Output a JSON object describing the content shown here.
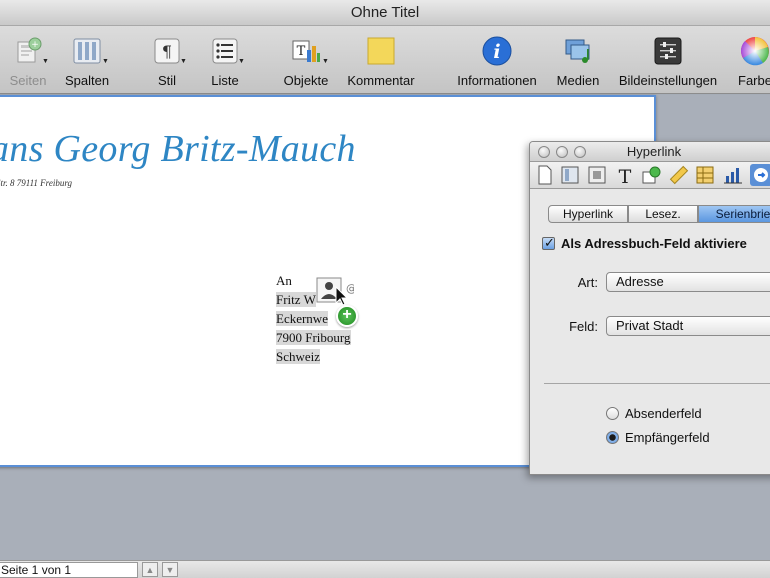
{
  "window": {
    "title": "Ohne Titel"
  },
  "toolbar": {
    "items": [
      {
        "label": "Seiten",
        "icon": "pages-icon",
        "enabled": false
      },
      {
        "label": "Spalten",
        "icon": "columns-icon",
        "enabled": true
      },
      {
        "label": "Stil",
        "icon": "paragraph-style-icon",
        "enabled": true
      },
      {
        "label": "Liste",
        "icon": "list-icon",
        "enabled": true
      },
      {
        "label": "Objekte",
        "icon": "objects-icon",
        "enabled": true
      },
      {
        "label": "Kommentar",
        "icon": "comment-icon",
        "enabled": true
      },
      {
        "label": "Informationen",
        "icon": "info-icon",
        "enabled": true
      },
      {
        "label": "Medien",
        "icon": "media-icon",
        "enabled": true
      },
      {
        "label": "Bildeinstellungen",
        "icon": "image-adjust-icon",
        "enabled": true
      },
      {
        "label": "Farbe",
        "icon": "color-wheel-icon",
        "enabled": true
      }
    ]
  },
  "document": {
    "sender_name": "ans Georg Britz-Mauch",
    "sender_address": "Str. 8 79111 Freiburg",
    "recipient": {
      "salutation": "An",
      "lines": [
        "Fritz W",
        "Eckernwe",
        "7900 Fribourg",
        "Schweiz"
      ]
    }
  },
  "status": {
    "page_info": "Seite 1 von 1",
    "prev_symbol": "▲",
    "next_symbol": "▼"
  },
  "inspector": {
    "title": "Hyperlink",
    "tabs": [
      "Hyperlink",
      "Lesez.",
      "Serienbrie"
    ],
    "selected_tab": "Serienbrie",
    "checkbox_label": "Als Adressbuch-Feld aktiviere",
    "checkbox_checked": true,
    "art_label": "Art:",
    "art_value": "Adresse",
    "feld_label": "Feld:",
    "feld_value": "Privat Stadt",
    "radio_options": [
      "Absenderfeld",
      "Empfängerfeld"
    ],
    "radio_selected": "Empfängerfeld"
  },
  "colors": {
    "accent": "#5a8fd6",
    "sender_name": "#2e86c4",
    "info_blue": "#2a6fd6",
    "comment_yellow": "#f3d75a"
  }
}
